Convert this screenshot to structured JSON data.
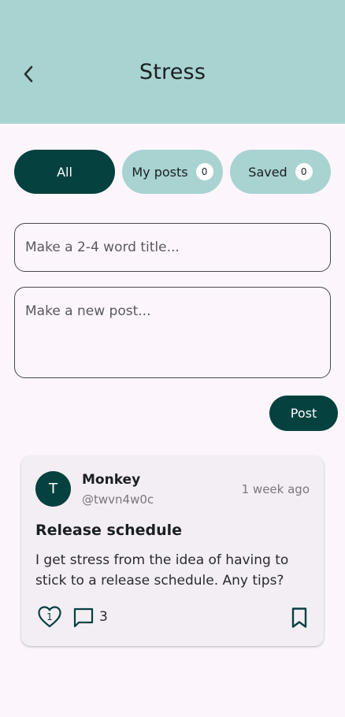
{
  "header": {
    "title": "Stress",
    "back_icon": "chevron-left-icon",
    "bg_color": "#a8d3d1"
  },
  "tabs": [
    {
      "label": "All",
      "active": true
    },
    {
      "label": "My posts",
      "count": "0",
      "active": false
    },
    {
      "label": "Saved",
      "count": "0",
      "active": false
    }
  ],
  "composer": {
    "title_placeholder": "Make a 2-4 word title...",
    "post_placeholder": "Make a new post...",
    "post_button": "Post"
  },
  "posts": [
    {
      "avatar_letter": "T",
      "author": "Monkey",
      "handle": "@twvn4w0c",
      "time": "1 week ago",
      "title": "Release schedule",
      "body": "I get stress from the idea of having to stick to a release schedule. Any tips?",
      "likes": "1",
      "comments": "3",
      "icons": {
        "like": "heart-icon",
        "comment": "comment-icon",
        "save": "bookmark-icon"
      }
    }
  ],
  "colors": {
    "accent": "#04413f",
    "accent_light": "#a8d3d1",
    "background": "#fcf6fc",
    "card": "#f3eef3"
  }
}
